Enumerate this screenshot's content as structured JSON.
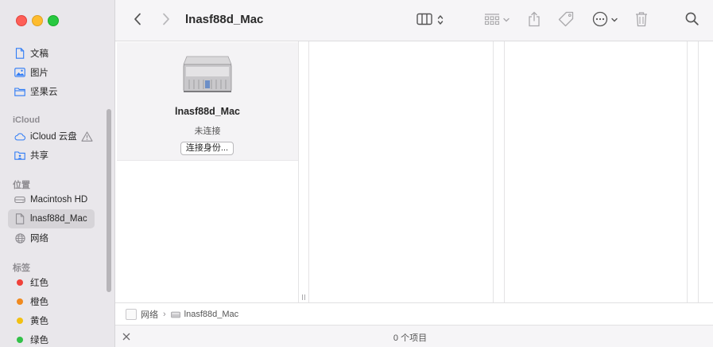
{
  "window": {
    "title": "lnasf88d_Mac"
  },
  "sidebar": {
    "favorites": [
      {
        "label": "文稿",
        "icon": "document-icon"
      },
      {
        "label": "图片",
        "icon": "photo-icon"
      },
      {
        "label": "坚果云",
        "icon": "folder-icon"
      }
    ],
    "icloud_header": "iCloud",
    "icloud": [
      {
        "label": "iCloud 云盘",
        "icon": "cloud-icon"
      },
      {
        "label": "共享",
        "icon": "shared-folder-icon"
      }
    ],
    "locations_header": "位置",
    "locations": [
      {
        "label": "Macintosh HD",
        "icon": "disk-icon"
      },
      {
        "label": "lnasf88d_Mac",
        "icon": "document-icon"
      },
      {
        "label": "网络",
        "icon": "globe-icon"
      }
    ],
    "tags_header": "标签",
    "tags": [
      {
        "label": "红色",
        "color": "#f0413a"
      },
      {
        "label": "橙色",
        "color": "#f08a1f"
      },
      {
        "label": "黄色",
        "color": "#f2c012"
      },
      {
        "label": "绿色",
        "color": "#33c149"
      }
    ]
  },
  "content": {
    "server_name": "lnasf88d_Mac",
    "status": "未连接",
    "connect_button": "连接身份..."
  },
  "pathbar": {
    "items": [
      "网络",
      "lnasf88d_Mac"
    ]
  },
  "statusbar": {
    "text": "0 个项目"
  }
}
